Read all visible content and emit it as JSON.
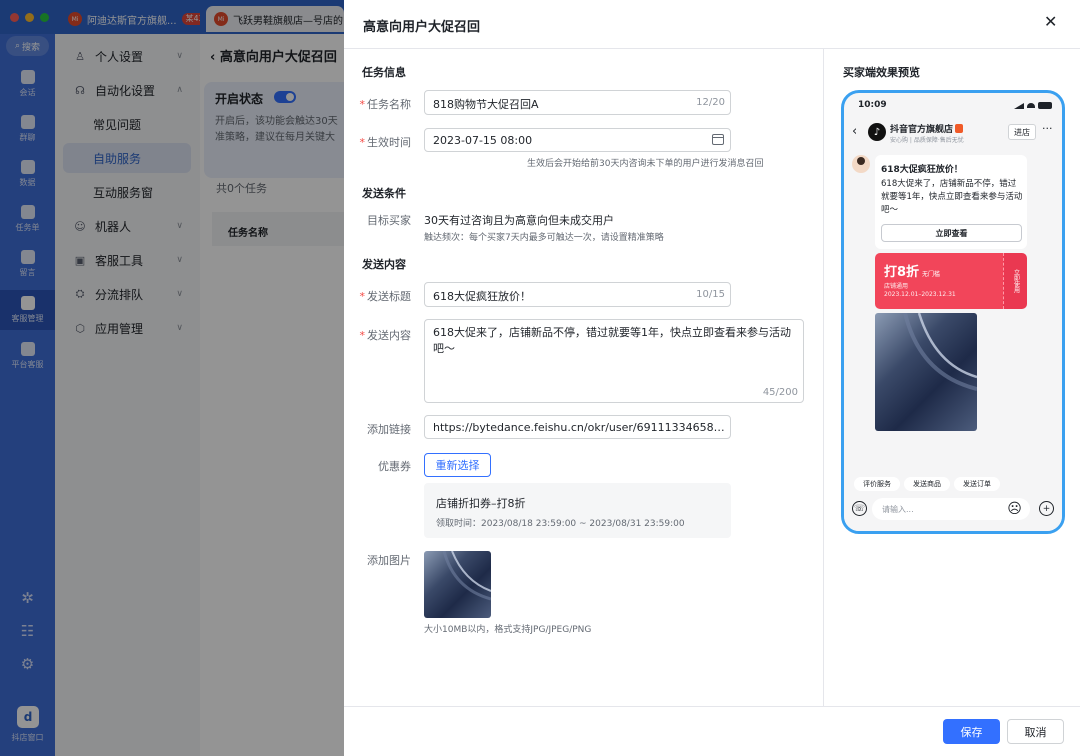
{
  "window": {
    "tabs": [
      {
        "label": "阿迪达斯官方旗舰...",
        "badge": "某43",
        "avatar": "Mi"
      },
      {
        "label": "飞跃男鞋旗舰店—号店的",
        "avatar": "Mi"
      }
    ],
    "colors": {
      "accent": "#3370ff",
      "rail": "#3f6fd8",
      "titlebar": "#2f64c9"
    }
  },
  "rail": {
    "search": "搜索",
    "items": [
      {
        "label": "会话",
        "icon": "chat-icon"
      },
      {
        "label": "群聊",
        "icon": "group-icon"
      },
      {
        "label": "数据",
        "icon": "chart-icon"
      },
      {
        "label": "任务单",
        "icon": "task-icon"
      },
      {
        "label": "留言",
        "icon": "message-icon"
      },
      {
        "label": "客服管理",
        "icon": "grid-icon",
        "active": true
      },
      {
        "label": "平台客服",
        "icon": "support-icon"
      }
    ],
    "logo_label": "抖店窗口",
    "logo_glyph": "d"
  },
  "menu": {
    "items": [
      {
        "label": "个人设置",
        "icon": "user-icon",
        "arrow": "∨"
      },
      {
        "label": "自动化设置",
        "icon": "headset-icon",
        "arrow": "∧"
      },
      {
        "label": "常见问题"
      },
      {
        "label": "自助服务",
        "active": true
      },
      {
        "label": "互动服务窗"
      },
      {
        "label": "机器人",
        "icon": "robot-icon",
        "arrow": "∨"
      },
      {
        "label": "客服工具",
        "icon": "toolbox-icon",
        "arrow": "∨"
      },
      {
        "label": "分流排队",
        "icon": "flow-icon",
        "arrow": "∨"
      },
      {
        "label": "应用管理",
        "icon": "app-icon",
        "arrow": "∨"
      }
    ]
  },
  "content": {
    "title": "高意向用户大促召回",
    "card_title": "开启状态",
    "card_desc": "开启后，该功能会触达30天准策略，建议在每月关键大",
    "count": "共0个任务",
    "table_header": "任务名称"
  },
  "drawer": {
    "title": "高意向用户大促召回",
    "section_task": "任务信息",
    "task_name": {
      "label": "任务名称",
      "value": "818购物节大促召回A",
      "counter": "12/20"
    },
    "effective_time": {
      "label": "生效时间",
      "value": "2023-07-15 08:00",
      "hint": "生效后会开始给前30天内咨询未下单的用户进行发消息召回"
    },
    "section_condition": "发送条件",
    "target": {
      "label": "目标买家",
      "value": "30天有过咨询且为高意向但未成交用户",
      "hint": "触达频次：每个买家7天内最多可触达一次，请设置精准策略"
    },
    "section_content": "发送内容",
    "send_title": {
      "label": "发送标题",
      "value": "618大促疯狂放价！",
      "counter": "10/15"
    },
    "send_content": {
      "label": "发送内容",
      "value": "618大促来了，店铺新品不停，错过就要等1年，快点立即查看来参与活动吧～",
      "counter": "45/200"
    },
    "link": {
      "label": "添加链接",
      "value": "https://bytedance.feishu.cn/okr/user/69111334658323..."
    },
    "coupon": {
      "label": "优惠券",
      "button": "重新选择",
      "name": "店铺折扣券–打8折",
      "time": "领取时间：2023/08/18 23:59:00 ~ 2023/08/31 23:59:00"
    },
    "image": {
      "label": "添加图片",
      "hint": "大小10MB以内，格式支持JPG/JPEG/PNG"
    },
    "preview_title": "买家端效果预览",
    "save": "保存",
    "cancel": "取消"
  },
  "phone": {
    "time": "10:09",
    "shop": "抖音官方旗舰店",
    "shop_sub": "安心购 | 品质保障·售后无忧",
    "enter": "进店",
    "more": "···",
    "bubble_title": "618大促疯狂放价！",
    "bubble_body": "618大促来了，店铺新品不停，错过就要等1年，快点立即查看来参与活动吧～",
    "bubble_button": "立即查看",
    "coupon_big": "打8折",
    "coupon_small": "无门槛",
    "coupon_scope": "店铺通用",
    "coupon_time": "2023.12.01–2023.12.31",
    "coupon_action": "立即使用",
    "quick": [
      "评价服务",
      "发送商品",
      "发送订单"
    ],
    "input_placeholder": "请输入..."
  }
}
